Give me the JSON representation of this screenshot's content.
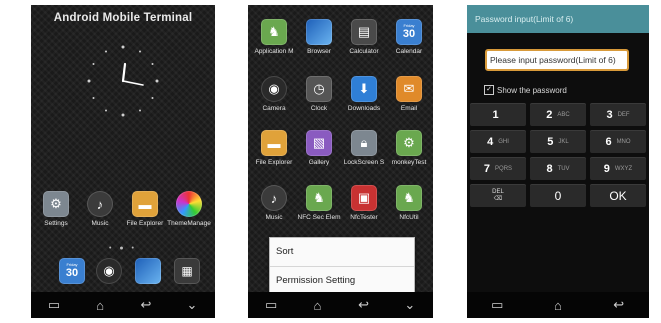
{
  "screen1": {
    "title": "Android Mobile Terminal",
    "dock_apps": [
      {
        "label": "Settings",
        "icon": "settings-icon"
      },
      {
        "label": "Music",
        "icon": "music-icon"
      },
      {
        "label": "File Explorer",
        "icon": "folder-icon"
      },
      {
        "label": "ThemeManage",
        "icon": "theme-icon"
      }
    ],
    "page_dots": "• ● •",
    "hotseat": [
      {
        "icon": "calendar-icon",
        "text": "30",
        "top": "Friday"
      },
      {
        "icon": "camera-icon"
      },
      {
        "icon": "browser-icon"
      },
      {
        "icon": "app-drawer-icon"
      }
    ],
    "nav": [
      "▭",
      "⌂",
      "↩",
      "⌄"
    ]
  },
  "screen2": {
    "apps": [
      {
        "label": "Application M",
        "icon": "android-icon"
      },
      {
        "label": "Browser",
        "icon": "browser-icon"
      },
      {
        "label": "Calculator",
        "icon": "calculator-icon"
      },
      {
        "label": "Calendar",
        "icon": "calendar-icon"
      },
      {
        "label": "Camera",
        "icon": "camera-icon"
      },
      {
        "label": "Clock",
        "icon": "clock-icon"
      },
      {
        "label": "Downloads",
        "icon": "download-icon"
      },
      {
        "label": "Email",
        "icon": "email-icon"
      },
      {
        "label": "File Explorer",
        "icon": "folder-icon"
      },
      {
        "label": "Gallery",
        "icon": "gallery-icon"
      },
      {
        "label": "LockScreen S",
        "icon": "lock-icon"
      },
      {
        "label": "monkeyTest",
        "icon": "android-gear-icon"
      },
      {
        "label": "Music",
        "icon": "music-icon"
      },
      {
        "label": "NFC Sec Elem",
        "icon": "android-icon"
      },
      {
        "label": "NfcTester",
        "icon": "nfc-icon"
      },
      {
        "label": "NfcUtil",
        "icon": "android-icon"
      }
    ],
    "calendar_day": "30",
    "calendar_top": "Friday",
    "menu": [
      "Sort",
      "Permission Setting"
    ],
    "nav": [
      "▭",
      "⌂",
      "↩",
      "⌄"
    ]
  },
  "screen3": {
    "title": "Password input(Limit of 6)",
    "field_placeholder": "Please input password(Limit of 6)",
    "show_password_label": "Show the password",
    "keys": [
      {
        "d": "1",
        "l": ""
      },
      {
        "d": "2",
        "l": "ABC"
      },
      {
        "d": "3",
        "l": "DEF"
      },
      {
        "d": "4",
        "l": "GHI"
      },
      {
        "d": "5",
        "l": "JKL"
      },
      {
        "d": "6",
        "l": "MNO"
      },
      {
        "d": "7",
        "l": "PQRS"
      },
      {
        "d": "8",
        "l": "TUV"
      },
      {
        "d": "9",
        "l": "WXYZ"
      }
    ],
    "delete_label": "DEL",
    "zero_key": "0",
    "ok_key": "OK",
    "nav": [
      "▭",
      "⌂",
      "↩"
    ]
  },
  "colors": {
    "pw_bar": "#4a8f9a",
    "pw_field_border": "#d89a3a"
  }
}
